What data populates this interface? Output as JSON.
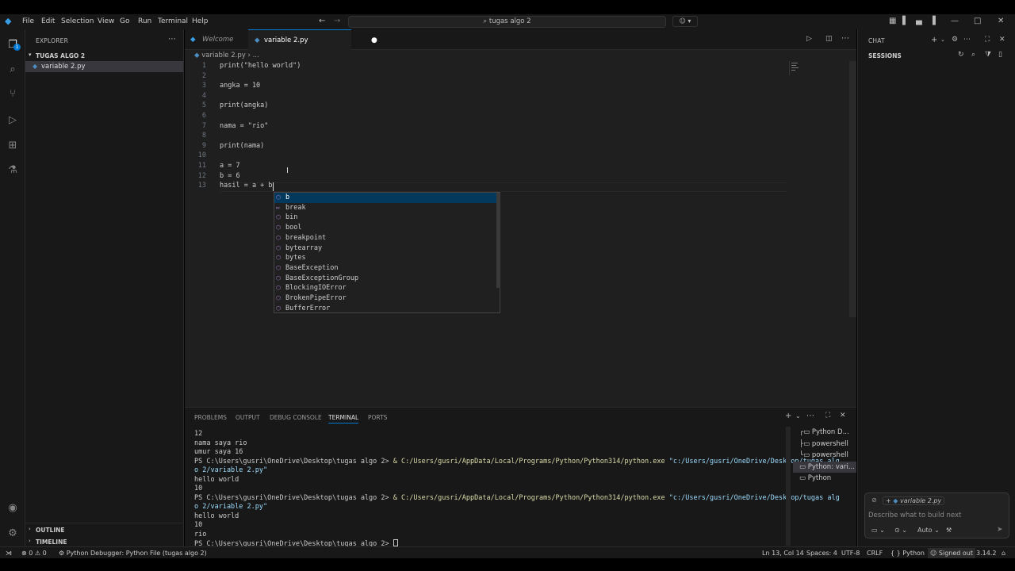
{
  "menu": [
    "File",
    "Edit",
    "Selection",
    "View",
    "Go",
    "Run",
    "Terminal",
    "Help"
  ],
  "command_center": "tugas algo 2",
  "explorer": {
    "title": "EXPLORER",
    "folder": "TUGAS ALGO 2",
    "file": "variable 2.py",
    "outline": "OUTLINE",
    "timeline": "TIMELINE"
  },
  "activity_badge": "1",
  "tabs": {
    "welcome": "Welcome",
    "active": "variable 2.py"
  },
  "breadcrumb": {
    "file": "variable 2.py",
    "rest": "..."
  },
  "code_lines": [
    {
      "n": "1",
      "t": "print(\"hello world\")"
    },
    {
      "n": "2",
      "t": ""
    },
    {
      "n": "3",
      "t": "angka = 10"
    },
    {
      "n": "4",
      "t": ""
    },
    {
      "n": "5",
      "t": "print(angka)"
    },
    {
      "n": "6",
      "t": ""
    },
    {
      "n": "7",
      "t": "nama = \"rio\""
    },
    {
      "n": "8",
      "t": ""
    },
    {
      "n": "9",
      "t": "print(nama)"
    },
    {
      "n": "10",
      "t": ""
    },
    {
      "n": "11",
      "t": "a = 7"
    },
    {
      "n": "12",
      "t": "b = 6"
    },
    {
      "n": "13",
      "t": "hasil = a + b"
    }
  ],
  "suggestions": [
    "b",
    "break",
    "bin",
    "bool",
    "breakpoint",
    "bytearray",
    "bytes",
    "BaseException",
    "BaseExceptionGroup",
    "BlockingIOError",
    "BrokenPipeError",
    "BufferError"
  ],
  "panel_tabs": [
    "PROBLEMS",
    "OUTPUT",
    "DEBUG CONSOLE",
    "TERMINAL",
    "PORTS"
  ],
  "terminal": {
    "l1": "12",
    "l2": "nama saya rio",
    "l3": "umur saya 16",
    "prompt": "PS C:\\Users\\gusri\\OneDrive\\Desktop\\tugas algo 2> ",
    "amp": "& ",
    "exe": "C:/Users/gusri/AppData/Local/Programs/Python/Python314/python.exe",
    "arg_a": "\"c:/Users/gusri/OneDrive/Desktop/tugas alg",
    "arg_b": "o 2/variable 2.py\"",
    "o1": "hello world",
    "o2": "10",
    "o3": "hello world",
    "o4": "10",
    "o5": "rio",
    "final_prompt": "PS C:\\Users\\gusri\\OneDrive\\Desktop\\tugas algo 2> "
  },
  "terminal_list": [
    "Python D...",
    "powershell",
    "powershell",
    "Python: vari...",
    "Python"
  ],
  "chat": {
    "title": "CHAT",
    "sessions": "SESSIONS",
    "context_file": "variable 2.py",
    "placeholder": "Describe what to build next",
    "auto": "Auto"
  },
  "status": {
    "errors": "0",
    "warnings": "0",
    "debugger": "Python Debugger: Python File (tugas algo 2)",
    "position": "Ln 13, Col 14",
    "spaces": "Spaces: 4",
    "encoding": "UTF-8",
    "eol": "CRLF",
    "language": "Python",
    "account": "Signed out",
    "version": "3.14.2"
  }
}
